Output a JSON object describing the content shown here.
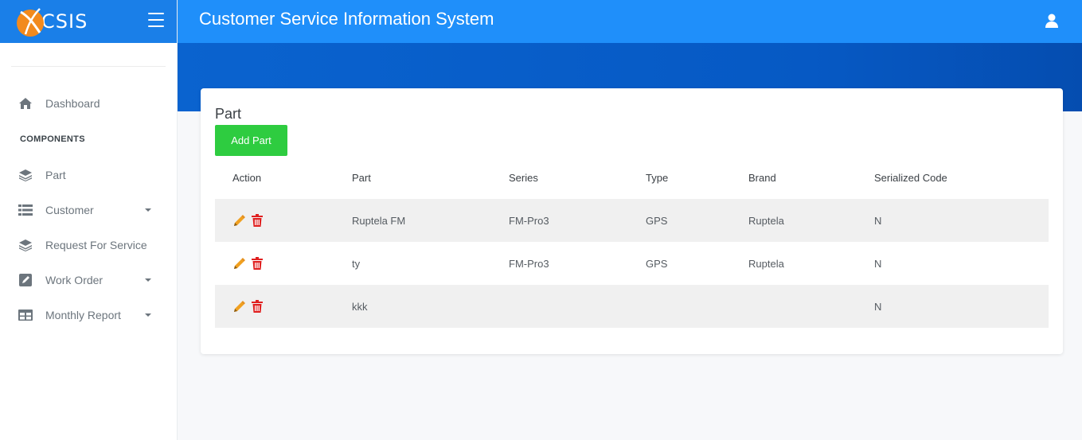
{
  "brand": {
    "logo_text": "CSIS",
    "accent": "#f28a1e"
  },
  "header": {
    "title": "Customer Service Information System",
    "user_icon": "user-icon"
  },
  "sidebar": {
    "items_top": [
      {
        "label": "Dashboard",
        "icon": "home-icon"
      }
    ],
    "section_heading": "COMPONENTS",
    "items": [
      {
        "label": "Part",
        "icon": "layers-icon",
        "has_caret": false
      },
      {
        "label": "Customer",
        "icon": "list-icon",
        "has_caret": true
      },
      {
        "label": "Request For Service",
        "icon": "layers-icon",
        "has_caret": false
      },
      {
        "label": "Work Order",
        "icon": "edit-square-icon",
        "has_caret": true
      },
      {
        "label": "Monthly Report",
        "icon": "table-icon",
        "has_caret": true
      }
    ]
  },
  "main": {
    "card_title": "Part",
    "add_button_label": "Add Part",
    "table": {
      "columns": [
        "Action",
        "Part",
        "Series",
        "Type",
        "Brand",
        "Serialized Code"
      ],
      "rows": [
        {
          "part": "Ruptela FM",
          "series": "FM-Pro3",
          "type": "GPS",
          "brand": "Ruptela",
          "serialized_code": "N"
        },
        {
          "part": "ty",
          "series": "FM-Pro3",
          "type": "GPS",
          "brand": "Ruptela",
          "serialized_code": "N"
        },
        {
          "part": "kkk",
          "series": "",
          "type": "",
          "brand": "",
          "serialized_code": "N"
        }
      ]
    }
  },
  "colors": {
    "topbar": "#1f8ffa",
    "brand_bar": "#1a7fe8",
    "add_button": "#2ecc40",
    "edit_icon": "#f0a020",
    "delete_icon": "#e02020"
  }
}
